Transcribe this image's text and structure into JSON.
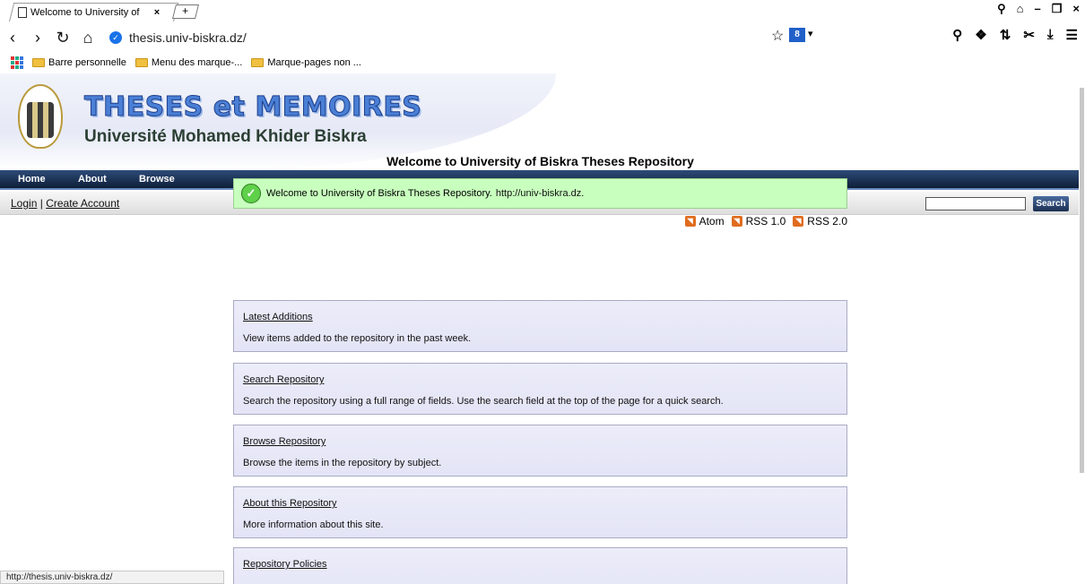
{
  "browser": {
    "tab_title": "Welcome to University of",
    "tab_close": "×",
    "new_tab": "+",
    "url": "thesis.univ-biskra.dz/",
    "window_controls": [
      "⚲",
      "⌂",
      "–",
      "❐",
      "×"
    ],
    "bookmarks": [
      {
        "label": "Barre personnelle"
      },
      {
        "label": "Menu des marque-..."
      },
      {
        "label": "Marque-pages non ..."
      }
    ],
    "status_url": "http://thesis.univ-biskra.dz/",
    "search_engine_badge": "8"
  },
  "site": {
    "title": "THESES et MEMOIRES",
    "subtitle": "Université Mohamed Khider Biskra",
    "menu": [
      "Home",
      "About",
      "Browse"
    ],
    "login": "Login",
    "separator": "|",
    "create_account": "Create Account",
    "search_button": "Search",
    "search_value": ""
  },
  "main": {
    "heading": "Welcome to University of Biskra Theses Repository",
    "notice_text": "Welcome to University of Biskra Theses Repository.",
    "notice_link": "http://univ-biskra.dz",
    "notice_end": ".",
    "feeds": [
      "Atom",
      "RSS 1.0",
      "RSS 2.0"
    ],
    "cards": [
      {
        "title": "Latest Additions",
        "description": "View items added to the repository in the past week."
      },
      {
        "title": "Search Repository",
        "description": "Search the repository using a full range of fields. Use the search field at the top of the page for a quick search."
      },
      {
        "title": "Browse Repository",
        "description": "Browse the items in the repository by subject."
      },
      {
        "title": "About this Repository",
        "description": "More information about this site."
      },
      {
        "title": "Repository Policies",
        "description": ""
      }
    ]
  }
}
